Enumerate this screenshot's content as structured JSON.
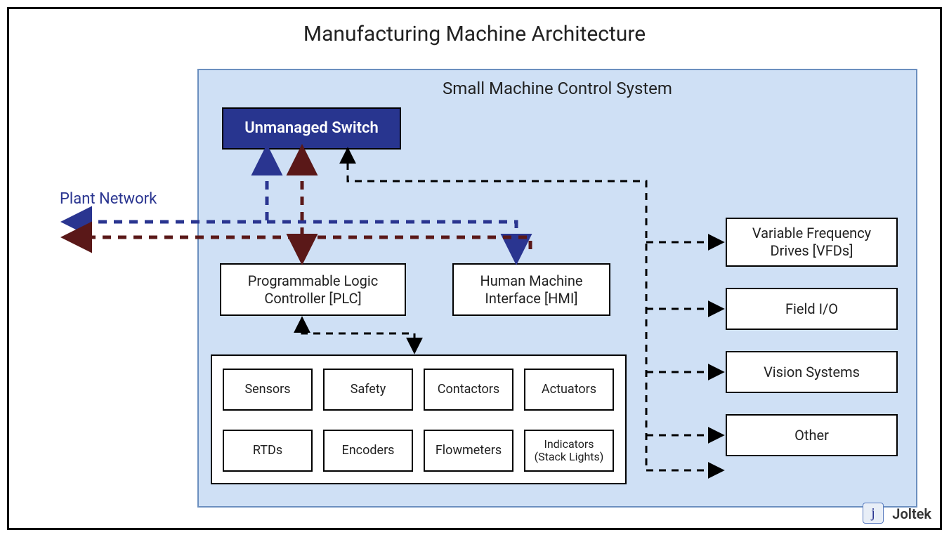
{
  "title": "Manufacturing Machine Architecture",
  "control_system": {
    "title": "Small Machine Control System",
    "switch": "Unmanaged Switch",
    "plc": "Programmable Logic Controller [PLC]",
    "hmi": "Human Machine Interface [HMI]"
  },
  "plant_network": "Plant Network",
  "io_devices": {
    "row1": [
      "Sensors",
      "Safety",
      "Contactors",
      "Actuators"
    ],
    "row2": [
      "RTDs",
      "Encoders",
      "Flowmeters",
      "Indicators (Stack Lights)"
    ]
  },
  "right_devices": [
    "Variable Frequency Drives [VFDs]",
    "Field I/O",
    "Vision Systems",
    "Other"
  ],
  "logo": {
    "icon": "j",
    "text": "Joltek"
  },
  "colors": {
    "switch_bg": "#28358f",
    "cs_bg": "#cfe0f5",
    "plant_line": "#2a3590",
    "alt_line": "#5a1818"
  }
}
